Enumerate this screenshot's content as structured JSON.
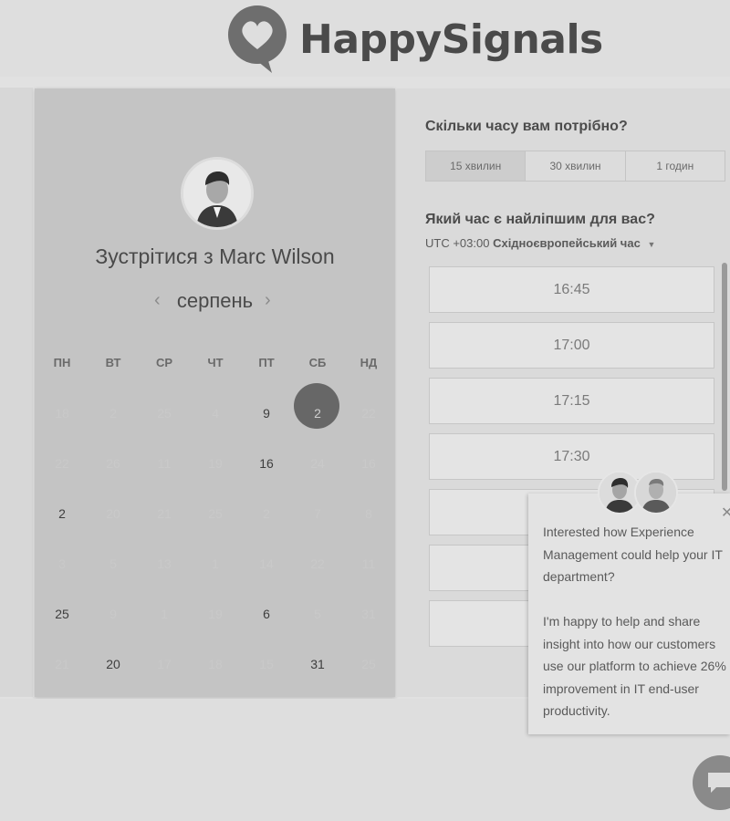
{
  "brand": {
    "name": "HappySignals",
    "logo_icon": "heart-speech-bubble-icon"
  },
  "scheduler": {
    "meet_title": "Зустрітися з Marc Wilson",
    "month": "серпень",
    "prev_icon": "chevron-left-icon",
    "next_icon": "chevron-right-icon",
    "weekdays": [
      "ПН",
      "ВТ",
      "СР",
      "ЧТ",
      "ПТ",
      "СБ",
      "НД"
    ],
    "weeks": [
      [
        {
          "d": "18",
          "s": "disabled"
        },
        {
          "d": "2",
          "s": "disabled"
        },
        {
          "d": "25",
          "s": "disabled"
        },
        {
          "d": "4",
          "s": "disabled"
        },
        {
          "d": "9",
          "s": "available"
        },
        {
          "d": "2",
          "s": "selected"
        },
        {
          "d": "22",
          "s": "disabled"
        }
      ],
      [
        {
          "d": "22",
          "s": "disabled"
        },
        {
          "d": "26",
          "s": "disabled"
        },
        {
          "d": "11",
          "s": "disabled"
        },
        {
          "d": "19",
          "s": "disabled"
        },
        {
          "d": "16",
          "s": "available"
        },
        {
          "d": "24",
          "s": "disabled"
        },
        {
          "d": "16",
          "s": "disabled"
        }
      ],
      [
        {
          "d": "2",
          "s": "available"
        },
        {
          "d": "20",
          "s": "disabled"
        },
        {
          "d": "21",
          "s": "disabled"
        },
        {
          "d": "25",
          "s": "disabled"
        },
        {
          "d": "2",
          "s": "disabled"
        },
        {
          "d": "7",
          "s": "disabled"
        },
        {
          "d": "8",
          "s": "disabled"
        }
      ],
      [
        {
          "d": "3",
          "s": "disabled"
        },
        {
          "d": "5",
          "s": "disabled"
        },
        {
          "d": "13",
          "s": "disabled"
        },
        {
          "d": "1",
          "s": "disabled"
        },
        {
          "d": "14",
          "s": "disabled"
        },
        {
          "d": "22",
          "s": "disabled"
        },
        {
          "d": "11",
          "s": "disabled"
        }
      ],
      [
        {
          "d": "25",
          "s": "available"
        },
        {
          "d": "9",
          "s": "disabled"
        },
        {
          "d": "1",
          "s": "disabled"
        },
        {
          "d": "19",
          "s": "disabled"
        },
        {
          "d": "6",
          "s": "available"
        },
        {
          "d": "5",
          "s": "disabled"
        },
        {
          "d": "31",
          "s": "disabled"
        }
      ],
      [
        {
          "d": "21",
          "s": "disabled"
        },
        {
          "d": "20",
          "s": "available"
        },
        {
          "d": "17",
          "s": "disabled"
        },
        {
          "d": "18",
          "s": "disabled"
        },
        {
          "d": "15",
          "s": "disabled"
        },
        {
          "d": "31",
          "s": "available"
        },
        {
          "d": "25",
          "s": "disabled"
        }
      ]
    ]
  },
  "booking": {
    "duration_question": "Скільки часу вам потрібно?",
    "durations": [
      {
        "label": "15 хвилин",
        "active": true
      },
      {
        "label": "30 хвилин",
        "active": false
      },
      {
        "label": "1 годин",
        "active": false
      }
    ],
    "time_question": "Який час є найліпшим для вас?",
    "timezone_offset": "UTC +03:00",
    "timezone_name": "Східноєвропейський час",
    "timezone_caret_icon": "caret-down-icon",
    "slots": [
      "16:45",
      "17:00",
      "17:15",
      "17:30",
      "",
      "",
      "",
      ""
    ]
  },
  "chat": {
    "message": "Interested how Experience Management could help your IT department?\n\nI'm happy to help and share insight into how our customers use our platform to achieve 26% improvement in IT end-user productivity.",
    "close_icon": "close-icon",
    "launcher_icon": "chat-bubble-icon"
  }
}
